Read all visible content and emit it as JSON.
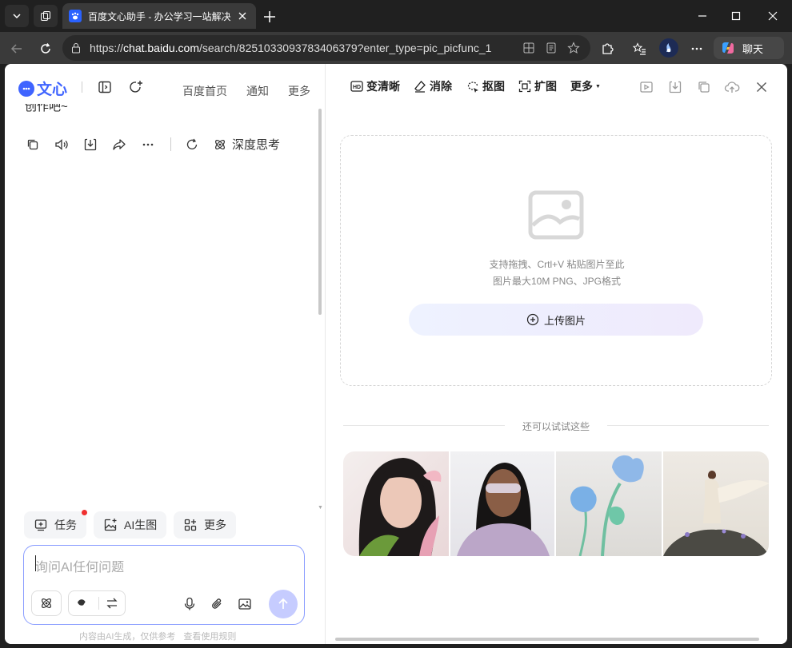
{
  "browser": {
    "tab_title": "百度文心助手 - 办公学习一站解决",
    "url_prefix": "https://",
    "url_host": "chat.baidu.com",
    "url_path": "/search/8251033093783406379?enter_type=pic_picfunc_1",
    "chat_label": "聊天"
  },
  "left": {
    "logo_text": "文心",
    "nav": [
      "百度首页",
      "通知",
      "更多"
    ],
    "cut_text": "创作吧~",
    "deep_think": "深度思考",
    "chips": {
      "task": "任务",
      "ai_image": "AI生图",
      "more": "更多"
    },
    "input_placeholder": "询问AI任何问题",
    "disclaimer": "内容由AI生成，仅供参考",
    "rules_link": "查看使用规则"
  },
  "right": {
    "tools": {
      "enhance": "变清晰",
      "erase": "消除",
      "cutout": "抠图",
      "expand": "扩图",
      "more": "更多"
    },
    "hint_line1": "支持拖拽、Crtl+V 粘贴图片至此",
    "hint_line2": "图片最大10M PNG、JPG格式",
    "upload_label": "上传图片",
    "try_label": "还可以试试这些"
  },
  "colors": {
    "brand": "#3f64ff",
    "send_disabled": "#c6ccff",
    "notification_dot": "#f03030"
  }
}
